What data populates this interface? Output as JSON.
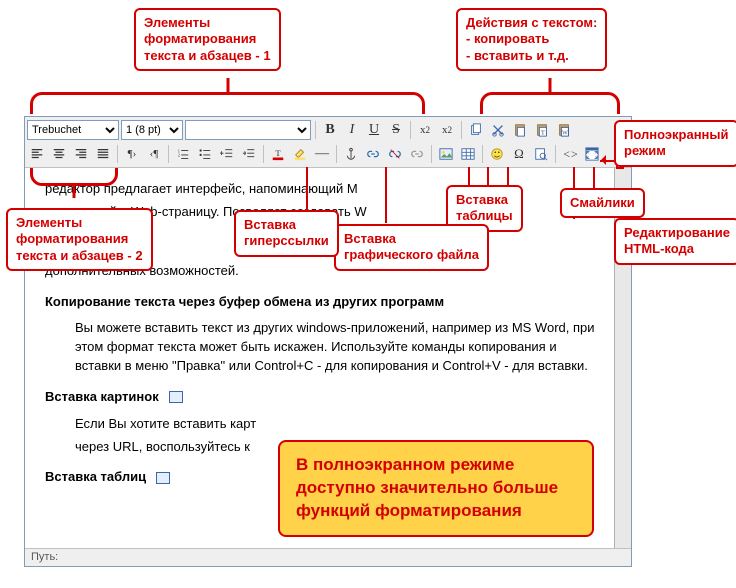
{
  "toolbar": {
    "font_options": [
      "Trebuchet"
    ],
    "font_value": "Trebuchet",
    "size_options": [
      "1 (8 pt)"
    ],
    "size_value": "1 (8 pt)",
    "style_options": [
      ""
    ],
    "style_value": "",
    "row1": {
      "bold": "B",
      "italic": "I",
      "underline": "U",
      "strike": "S",
      "sub": "x₂",
      "sup": "x²",
      "copy": "copy-icon",
      "cut": "cut-icon",
      "paste": "paste-icon",
      "pastetext": "paste-text-icon",
      "pasteword": "paste-word-icon"
    },
    "row2": {
      "align_left": "align-left-icon",
      "align_center": "align-center-icon",
      "align_right": "align-right-icon",
      "align_justify": "align-justify-icon",
      "ltr": "ltr-icon",
      "rtl": "rtl-icon",
      "ol": "ordered-list-icon",
      "ul": "unordered-list-icon",
      "outdent": "outdent-icon",
      "indent": "indent-icon",
      "textcolor": "text-color-icon",
      "bgcolor": "bg-color-icon",
      "hr": "hr-icon",
      "anchor": "anchor-icon",
      "link": "link-icon",
      "unlink": "unlink-icon",
      "nolink": "nolink-icon",
      "image": "image-icon",
      "table": "table-icon",
      "smiley": "smiley-icon",
      "char": "special-char-icon",
      "search": "search-icon",
      "html": "html-icon",
      "fullscreen": "fullscreen-icon"
    }
  },
  "content": {
    "p1a": "редактор предлагает интерфейс, напоминающий M",
    "p1b": "встроенный в Web-страницу. Позволяет создавать W",
    "p1c": "дополнительных возможностей.",
    "h1": "Копирование текста через буфер обмена из других программ",
    "p2": "Вы можете вставить текст из других windows-приложений, например из MS Word, при этом формат текста может быть искажен. Используйте команды копирования и вставки в меню \"Правка\" или Control+C - для копирования и Control+V - для вставки.",
    "h2": "Вставка картинок",
    "p3": "Если Вы хотите вставить карт",
    "p3b": "через URL, воспользуйтесь к",
    "h3": "Вставка таблиц"
  },
  "status": {
    "label": "Путь:"
  },
  "callouts": {
    "c1": "Элементы\nформатирования\nтекста и абзацев - 1",
    "c2": "Действия с текстом:\n- копировать\n- вставить и т.д.",
    "c3": "Полноэкранный\nрежим",
    "c4": "Смайлики",
    "c5": "Вставка\nтаблицы",
    "c6": "Редактирование\nHTML-кода",
    "c7": "Вставка\nграфического файла",
    "c8": "Вставка\nгиперссылки",
    "c9": "Элементы\nформатирования\nтекста и абзацев - 2"
  },
  "tip": "В полноэкранном режиме\nдоступно значительно больше\nфункций форматирования",
  "colors": {
    "accent": "#d40000",
    "tipbg": "#ffd24a"
  }
}
